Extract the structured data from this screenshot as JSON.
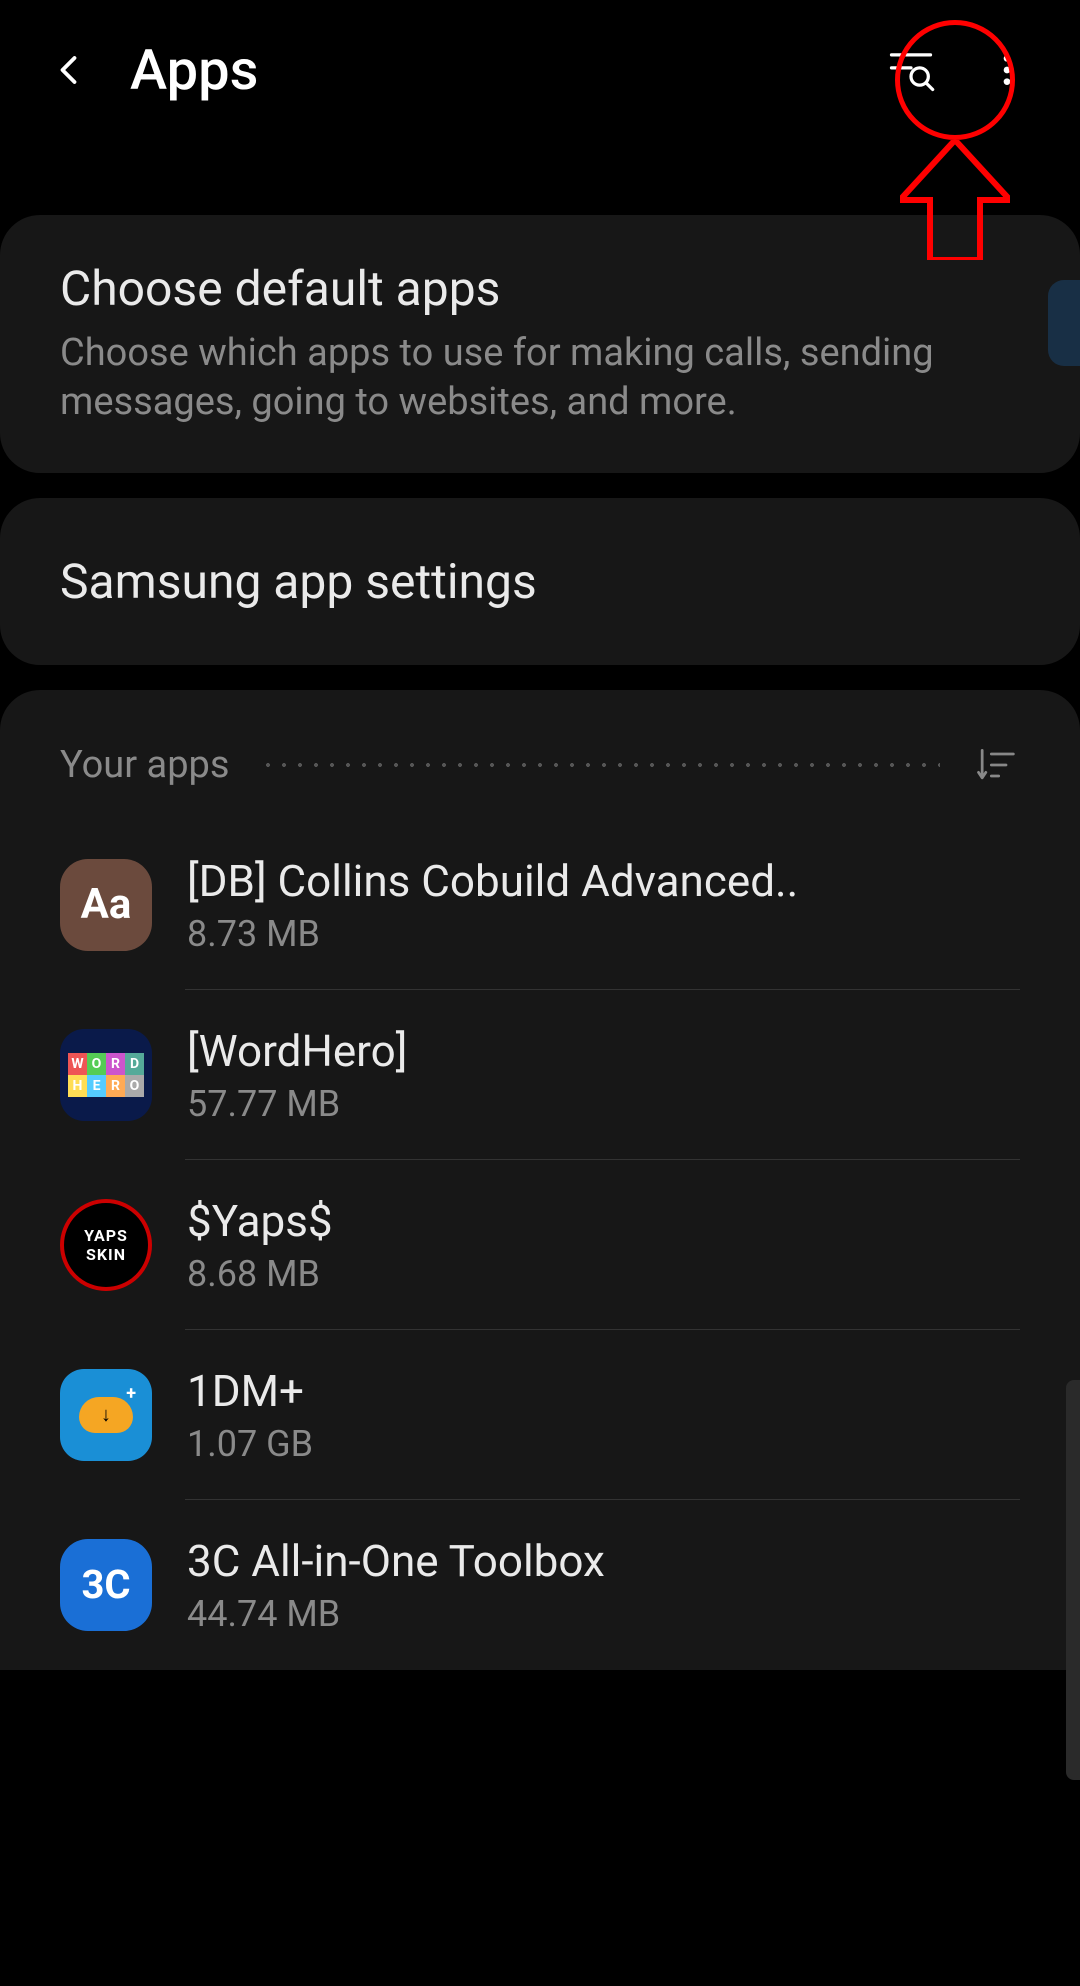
{
  "header": {
    "title": "Apps"
  },
  "default_apps": {
    "title": "Choose default apps",
    "desc": "Choose which apps to use for making calls, sending messages, going to websites, and more."
  },
  "samsung_settings": {
    "title": "Samsung app settings"
  },
  "apps_section": {
    "label": "Your apps"
  },
  "apps": [
    {
      "name": "[DB] Collins Cobuild Advanced..",
      "size": "8.73 MB"
    },
    {
      "name": "[WordHero]",
      "size": "57.77 MB"
    },
    {
      "name": "$Yaps$",
      "size": "8.68 MB"
    },
    {
      "name": "1DM+",
      "size": "1.07 GB"
    },
    {
      "name": "3C All-in-One Toolbox",
      "size": "44.74 MB"
    }
  ]
}
